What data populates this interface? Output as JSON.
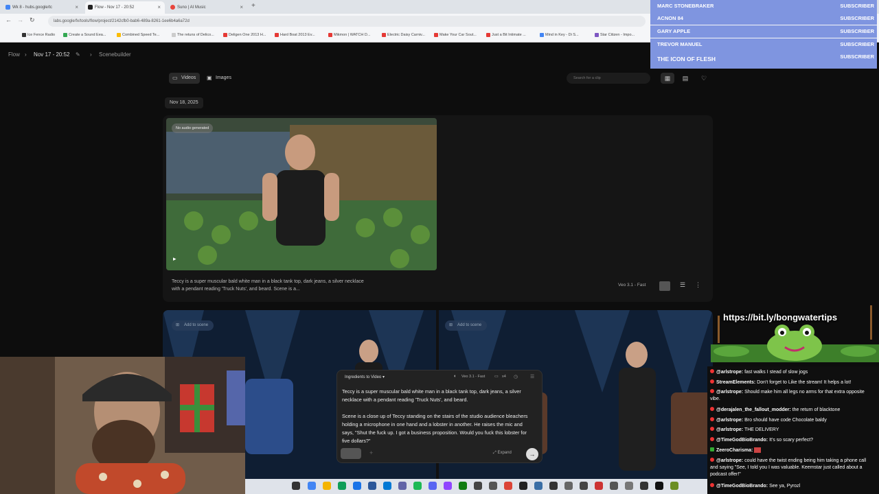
{
  "browser": {
    "tabs": [
      {
        "label": "Wk 8 - hubs.google/tc",
        "color": "#4285f4"
      },
      {
        "label": "Flow - Nov 17 - 20:52",
        "color": "#222222"
      },
      {
        "label": "Suno | AI Music",
        "color": "#e8453c"
      }
    ],
    "new_tab": "+",
    "url": "labs.google/fx/tools/flow/project/2142cfb0-bab6-489a-8261-1ee6b4a6a72d",
    "bookmarks": [
      {
        "label": "Ice Fence Radio",
        "color": "#333333"
      },
      {
        "label": "Create a Sound Eea...",
        "color": "#34a853"
      },
      {
        "label": "Combined Speed Te...",
        "color": "#fbbc05"
      },
      {
        "label": "The retuns of Delico...",
        "color": "#cccccc"
      },
      {
        "label": "Deligen One 2013 H...",
        "color": "#e53935"
      },
      {
        "label": "Hard Boat 2013 Ev...",
        "color": "#e53935"
      },
      {
        "label": "Mikmon | WATCH D...",
        "color": "#e53935"
      },
      {
        "label": "Electric Daisy Carniv...",
        "color": "#e53935"
      },
      {
        "label": "Make Your Car Sout...",
        "color": "#e53935"
      },
      {
        "label": "Just a Bit Intimate ...",
        "color": "#e53935"
      },
      {
        "label": "Mind in Key - Di S...",
        "color": "#4285f4"
      },
      {
        "label": "Star Citizen - Impo...",
        "color": "#7e57c2"
      }
    ]
  },
  "app": {
    "breadcrumb": {
      "root": "Flow",
      "project": "Nov 17 - 20:52",
      "page": "Scenebuilder"
    },
    "tabs": [
      {
        "label": "Videos"
      },
      {
        "label": "Images"
      }
    ],
    "search_placeholder": "Search for a clip",
    "date": "Nov 18, 2025",
    "card1": {
      "badge": "No audio generated",
      "description": "Teccy is a super muscular bald white man in a black tank top, dark jeans, a silver necklace with a pendant reading 'Truck Nuts', and beard. Scene is a...",
      "model": "Veo 3.1 - Fast"
    },
    "card2": {
      "add_to_scene": "Add to scene"
    },
    "prompt": {
      "mode": "Ingredients to Video",
      "model": "Veo 3.1 - Fast",
      "count": "x4",
      "text1": "Teccy is a super muscular bald white man in a black tank top, dark jeans, a silver necklace with a pendant reading 'Truck Nuts', and beard.",
      "text2": "Scene is a close up of Teccy standing on the stairs of the studio audience bleachers holding a microphone in one hand and a lobster in another. He raises the mic and says, \"Shut the fuck up. I got a business proposition. Would you fuck this lobster for five dollars?\"",
      "expand": "Expand"
    }
  },
  "stream": {
    "subscriber_label": "SUBSCRIBER",
    "subscribers": [
      "MARC STONEBRAKER",
      "ACNON 84",
      "GARY APPLE",
      "TREVOR MANUEL",
      "THE ICON OF FLESH"
    ],
    "link": "https://bit.ly/bongwatertips",
    "chat": [
      {
        "user": "@arlstrope:",
        "text": "fast walks I stead of slow jogs"
      },
      {
        "user": "StreamElements:",
        "text": "Don't forget to Like the stream! It helps a lot!"
      },
      {
        "user": "@arlstrope:",
        "text": "Should make him all legs no arms for that extra opposite vibe."
      },
      {
        "user": "@derajalen_the_fallout_modder:",
        "text": "the return of blacktone"
      },
      {
        "user": "@arlstrope:",
        "text": "Bro should have code Chocolate baldy"
      },
      {
        "user": "@arlstrope:",
        "text": "THE DELIVERY"
      },
      {
        "user": "@TimeGodBioBrando:",
        "text": "It's so scary perfect?"
      },
      {
        "user": "ZeeroCharisma:",
        "text": ""
      },
      {
        "user": "@arlstrope:",
        "text": "could have the twist ending being him taking a phone call and saying \"See, I told you I was valuable. Keemstar just called about a podcast offer!\""
      },
      {
        "user": "@TimeGodBioBrando:",
        "text": "See ya, Pyrozl"
      }
    ]
  }
}
